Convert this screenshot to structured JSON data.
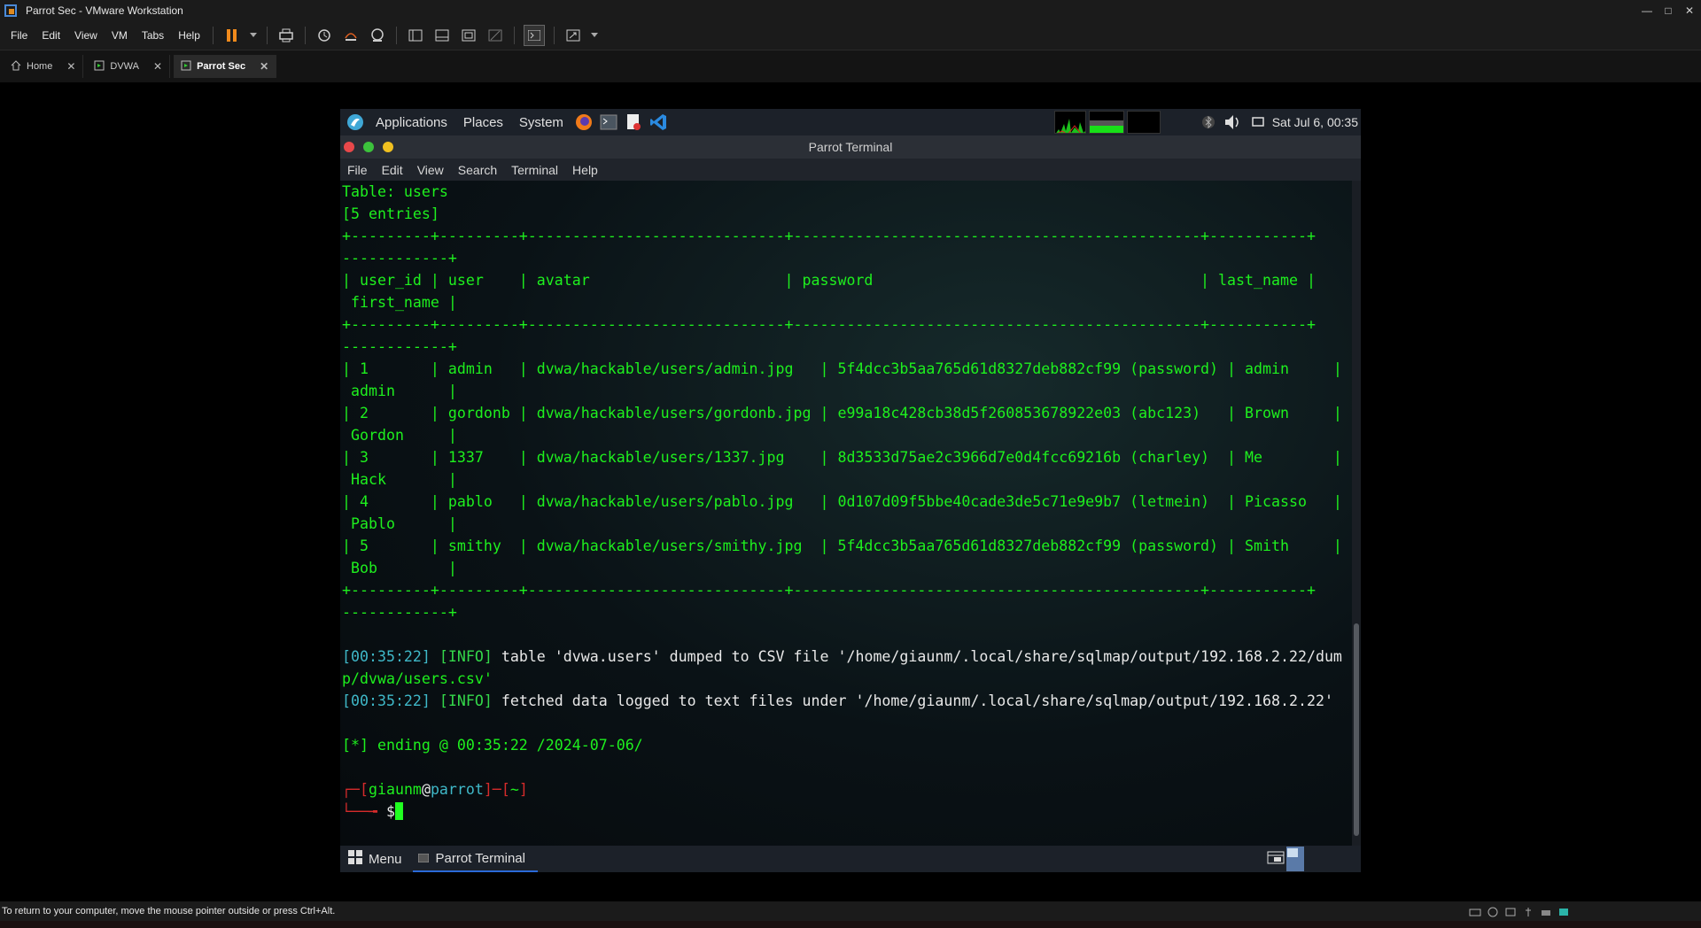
{
  "window": {
    "title": "Parrot Sec - VMware Workstation"
  },
  "vm_menu": [
    "File",
    "Edit",
    "View",
    "VM",
    "Tabs",
    "Help"
  ],
  "vm_tabs": [
    {
      "label": "Home",
      "icon": "home-icon"
    },
    {
      "label": "DVWA",
      "icon": "vm-icon"
    },
    {
      "label": "Parrot Sec",
      "icon": "vm-icon",
      "active": true
    }
  ],
  "guest_panel": {
    "menus": [
      "Applications",
      "Places",
      "System"
    ],
    "clock": "Sat Jul 6, 00:35"
  },
  "terminal": {
    "title": "Parrot Terminal",
    "menu": [
      "File",
      "Edit",
      "View",
      "Search",
      "Terminal",
      "Help"
    ],
    "table_header": "Table: users",
    "entries": "[5 entries]",
    "border_1": "+---------+---------+-----------------------------+----------------------------------------------+-----------+",
    "border_2": "------------+",
    "columns_line_1": "| user_id | user    | avatar                      | password                                     | last_name |",
    "columns_line_2": " first_name |",
    "rows": [
      {
        "line1": "| 1       | admin   | dvwa/hackable/users/admin.jpg   | 5f4dcc3b5aa765d61d8327deb882cf99 (password) | admin     |",
        "line2": " admin      |"
      },
      {
        "line1": "| 2       | gordonb | dvwa/hackable/users/gordonb.jpg | e99a18c428cb38d5f260853678922e03 (abc123)   | Brown     |",
        "line2": " Gordon     |"
      },
      {
        "line1": "| 3       | 1337    | dvwa/hackable/users/1337.jpg    | 8d3533d75ae2c3966d7e0d4fcc69216b (charley)  | Me        |",
        "line2": " Hack       |"
      },
      {
        "line1": "| 4       | pablo   | dvwa/hackable/users/pablo.jpg   | 0d107d09f5bbe40cade3de5c71e9e9b7 (letmein)  | Picasso   |",
        "line2": " Pablo      |"
      },
      {
        "line1": "| 5       | smithy  | dvwa/hackable/users/smithy.jpg  | 5f4dcc3b5aa765d61d8327deb882cf99 (password) | Smith     |",
        "line2": " Bob        |"
      }
    ],
    "log1_time": "[00:35:22]",
    "log1_level": "[INFO]",
    "log1_msg": " table 'dvwa.users' dumped to CSV file '/home/giaunm/.local/share/sqlmap/output/192.168.2.22/dum",
    "log1_cont": "p/dvwa/users.csv'",
    "log2_time": "[00:35:22]",
    "log2_level": "[INFO]",
    "log2_msg": " fetched data logged to text files under '/home/giaunm/.local/share/sqlmap/output/192.168.2.22'",
    "ending": "[*] ending @ 00:35:22 /2024-07-06/",
    "prompt_user": "giaunm",
    "prompt_at": "@",
    "prompt_host": "parrot",
    "prompt_dir": "~",
    "prompt_symbol": "$"
  },
  "bottom_panel": {
    "menu_label": "Menu",
    "task_label": "Parrot Terminal"
  },
  "status_bar": "To return to your computer, move the mouse pointer outside or press Ctrl+Alt."
}
